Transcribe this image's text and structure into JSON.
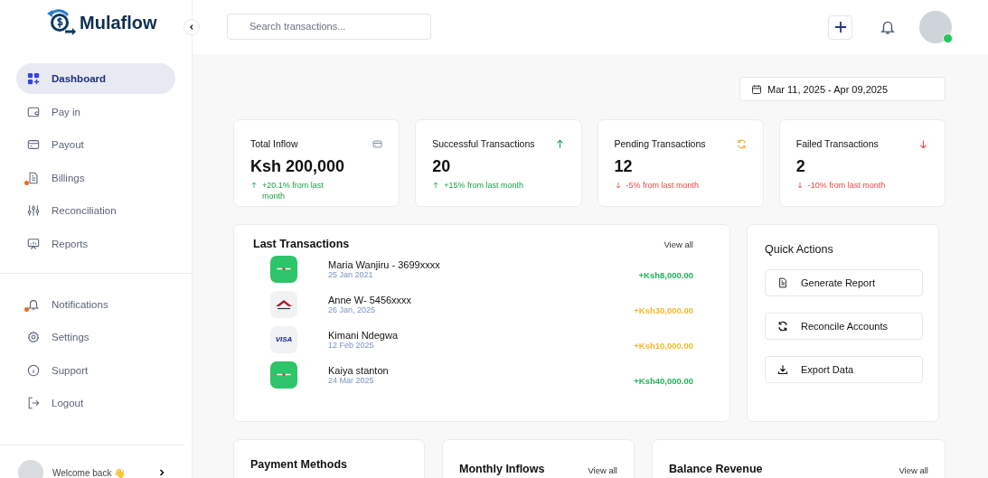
{
  "brand": {
    "name": "Mulaflow"
  },
  "sidebar": {
    "main_items": [
      {
        "label": "Dashboard",
        "kind": "grid",
        "selected": true,
        "badge": false
      },
      {
        "label": "Pay in",
        "kind": "wallet",
        "selected": false,
        "badge": false
      },
      {
        "label": "Payout",
        "kind": "card",
        "selected": false,
        "badge": false
      },
      {
        "label": "Billings",
        "kind": "document",
        "selected": false,
        "badge": true
      },
      {
        "label": "Reconciliation",
        "kind": "sliders",
        "selected": false,
        "badge": false
      },
      {
        "label": "Reports",
        "kind": "presentation",
        "selected": false,
        "badge": false
      }
    ],
    "secondary_items": [
      {
        "label": "Notifications",
        "kind": "bell",
        "selected": false,
        "badge": true
      },
      {
        "label": "Settings",
        "kind": "gear",
        "selected": false,
        "badge": false
      },
      {
        "label": "Support",
        "kind": "info",
        "selected": false,
        "badge": false
      },
      {
        "label": "Logout",
        "kind": "logout",
        "selected": false,
        "badge": false
      }
    ],
    "user": {
      "greeting": "Welcome back 👋"
    }
  },
  "header": {
    "search": {
      "placeholder": "Search transactions..."
    },
    "profile": {
      "online": true
    }
  },
  "date_range": "Mar 11, 2025 - Apr 09,2025",
  "stats": [
    {
      "title": "Total Inflow",
      "value": "Ksh 200,000",
      "kind": "card",
      "change": "+20.1% from last month",
      "trend_up": true
    },
    {
      "title": "Successful Transactions",
      "value": "20",
      "kind": "arrow-up",
      "change": "+15% from last month",
      "trend_up": true
    },
    {
      "title": "Pending Transactions",
      "value": "12",
      "kind": "refresh",
      "change": "-5% from last month",
      "trend_up": false
    },
    {
      "title": "Failed Transactions",
      "value": "2",
      "kind": "arrow-down",
      "change": "-10% from last month",
      "trend_up": false
    }
  ],
  "last_transactions": {
    "title": "Last Transactions",
    "view_all": "View all",
    "rows": [
      {
        "kind": "mpesa",
        "name": "Maria Wanjiru - 3699xxxx",
        "date": "25 Jan 2021",
        "amount": "+Ksh8,000.00",
        "color": "#22b35e"
      },
      {
        "kind": "equity",
        "name": "Anne W- 5456xxxx",
        "date": "26 Jan, 2025",
        "amount": "+Ksh30,000.00",
        "color": "#f5b82e"
      },
      {
        "kind": "visa",
        "logo_text": "VISA",
        "name": "Kimani Ndegwa",
        "date": "12 Feb 2025",
        "amount": "+Ksh10,000.00",
        "color": "#f5b82e"
      },
      {
        "kind": "mpesa",
        "name": "Kaiya stanton",
        "date": "24 Mar 2025",
        "amount": "+Ksh40,000.00",
        "color": "#22b35e"
      }
    ]
  },
  "quick_actions": {
    "title": "Quick Actions",
    "actions": [
      {
        "label": "Generate Report",
        "kind": "document"
      },
      {
        "label": "Reconcile Accounts",
        "kind": "refresh"
      },
      {
        "label": "Export Data",
        "kind": "download"
      }
    ]
  },
  "bottom_cards": [
    {
      "title": "Payment Methods"
    },
    {
      "title": "Monthly Inflows",
      "view_all": "View all"
    },
    {
      "title": "Balance Revenue",
      "view_all": "View all"
    }
  ]
}
